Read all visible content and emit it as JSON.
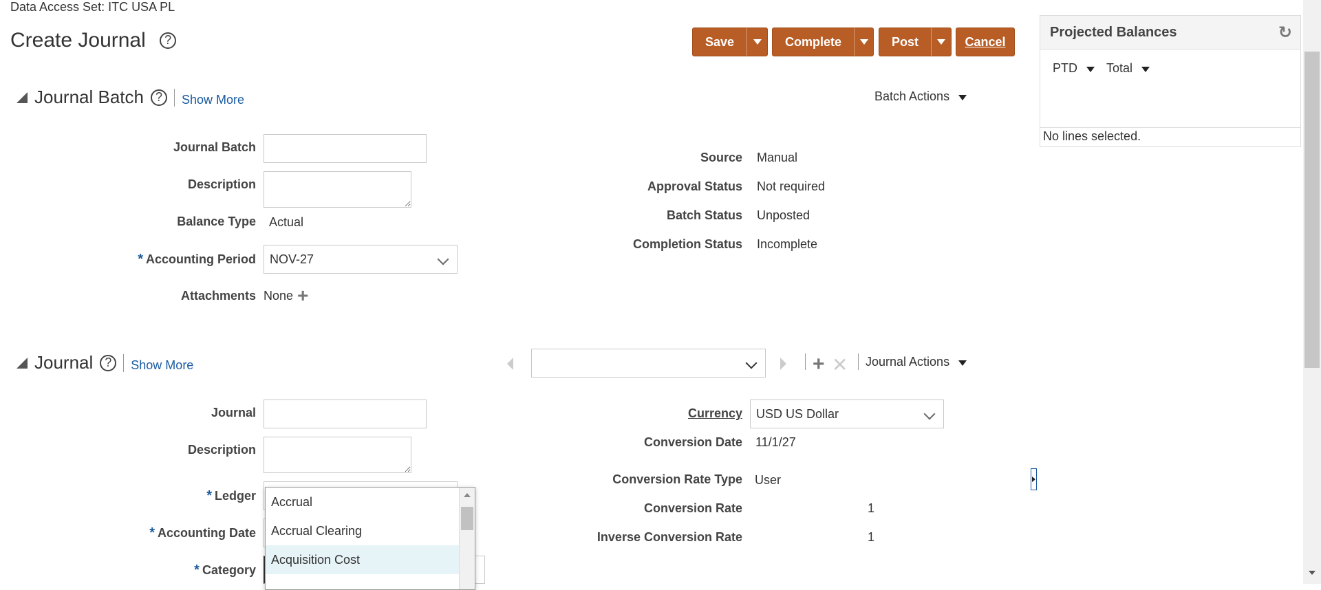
{
  "header": {
    "data_access_set": "Data Access Set:  ITC USA PL",
    "page_title": "Create Journal",
    "help": "?"
  },
  "toolbar": {
    "save_label": "Save",
    "complete_label": "Complete",
    "post_label": "Post",
    "cancel_label": "Cancel"
  },
  "projected_balances": {
    "title": "Projected Balances",
    "ptd_label": "PTD",
    "total_label": "Total",
    "empty_text": "No lines selected."
  },
  "journal_batch": {
    "title": "Journal Batch",
    "show_more": "Show More",
    "batch_actions": "Batch Actions",
    "fields": {
      "journal_batch_label": "Journal Batch",
      "description_label": "Description",
      "balance_type_label": "Balance Type",
      "balance_type_value": "Actual",
      "accounting_period_label": "Accounting Period",
      "accounting_period_value": "NOV-27",
      "attachments_label": "Attachments",
      "attachments_value": "None"
    },
    "status": {
      "source_label": "Source",
      "source_value": "Manual",
      "approval_status_label": "Approval Status",
      "approval_status_value": "Not required",
      "batch_status_label": "Batch Status",
      "batch_status_value": "Unposted",
      "completion_status_label": "Completion Status",
      "completion_status_value": "Incomplete"
    }
  },
  "journal": {
    "title": "Journal",
    "show_more": "Show More",
    "journal_actions": "Journal Actions",
    "fields": {
      "journal_label": "Journal",
      "description_label": "Description",
      "ledger_label": "Ledger",
      "accounting_date_label": "Accounting Date",
      "category_label": "Category"
    },
    "currency": {
      "currency_label": "Currency",
      "currency_value": "USD US Dollar",
      "conversion_date_label": "Conversion Date",
      "conversion_date_value": "11/1/27",
      "conversion_rate_type_label": "Conversion Rate Type",
      "conversion_rate_type_value": "User",
      "conversion_rate_label": "Conversion Rate",
      "conversion_rate_value": "1",
      "inverse_conversion_rate_label": "Inverse Conversion Rate",
      "inverse_conversion_rate_value": "1"
    }
  },
  "category_dropdown": {
    "options": [
      "Accrual",
      "Accrual Clearing",
      "Acquisition Cost"
    ],
    "highlighted": "Acquisition Cost"
  },
  "colors": {
    "button_bg": "#b85d25",
    "link": "#1a5ba0",
    "highlight": "#e6f4f8"
  }
}
